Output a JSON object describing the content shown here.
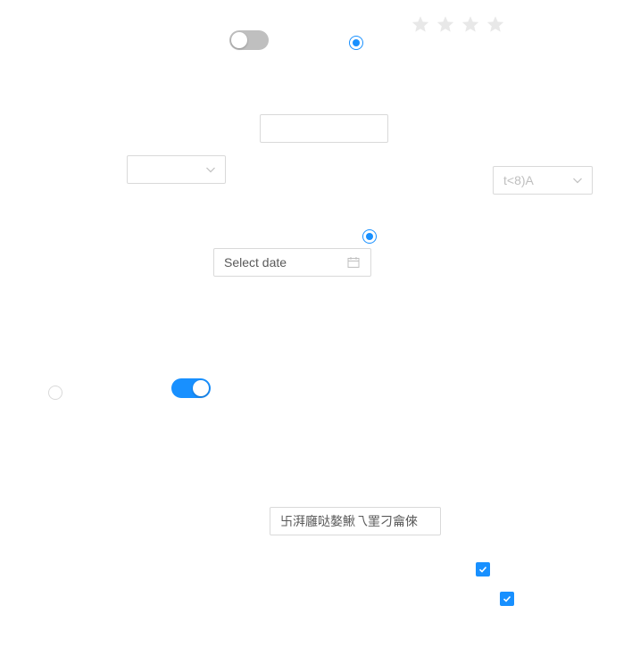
{
  "toggles": {
    "top_switch": {
      "checked": false
    },
    "left_switch": {
      "checked": true
    }
  },
  "radios": {
    "radio_top": {
      "checked": true
    },
    "radio_middle": {
      "checked": true
    },
    "radio_left": {
      "checked": false
    }
  },
  "rating": {
    "max": 4,
    "value": 0,
    "icon": "star-icon",
    "empty_color": "#e8e8e8"
  },
  "inputs": {
    "empty_input": {
      "value": ""
    },
    "text_input": {
      "value": "卐湃廱哒嫯鰍乁罣刁龠倈"
    }
  },
  "selects": {
    "left_select": {
      "value": ""
    },
    "right_select": {
      "value": "t<8)A",
      "disabled": true
    }
  },
  "date_picker": {
    "placeholder": "Select date",
    "icon": "calendar-icon"
  },
  "checkboxes": {
    "checkbox_1": {
      "checked": true
    },
    "checkbox_2": {
      "checked": true
    }
  },
  "colors": {
    "primary": "#1890ff",
    "border": "#d9d9d9",
    "switch_off": "#bfbfbf"
  }
}
